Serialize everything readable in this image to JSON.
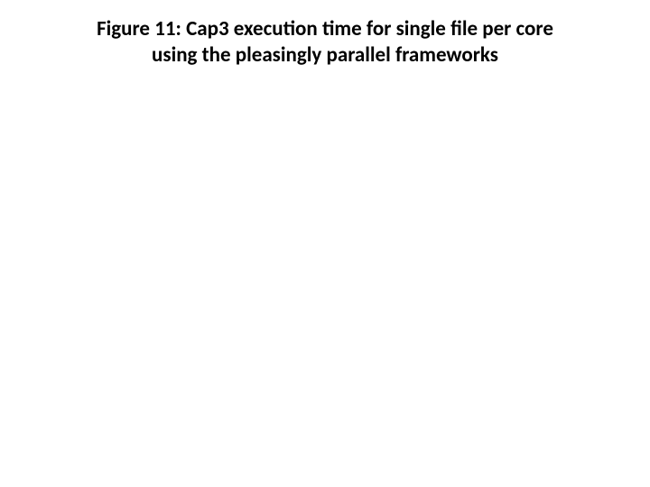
{
  "figure": {
    "caption_line1": "Figure 11: Cap3 execution time for single file per core",
    "caption_line2": "using the pleasingly parallel frameworks"
  }
}
